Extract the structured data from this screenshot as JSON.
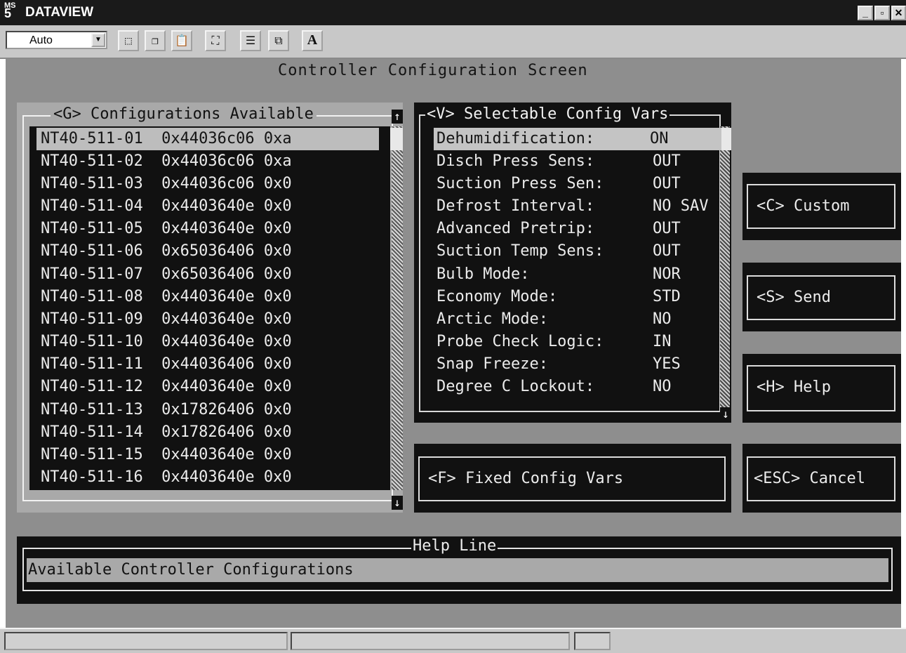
{
  "window": {
    "app_logo": "MS",
    "app_logo_num": "5",
    "title": "DATAVIEW",
    "minimize": "_",
    "maximize": "▫",
    "close": "✕"
  },
  "toolbar": {
    "zoom_value": "Auto",
    "zoom_arrow": "▼",
    "buttons": [
      {
        "icon": "select-rect-icon",
        "glyph": "⬚"
      },
      {
        "icon": "copy-icon",
        "glyph": "❐"
      },
      {
        "icon": "paste-icon",
        "glyph": "📋"
      },
      {
        "icon": "fullscreen-icon",
        "glyph": "⛶"
      },
      {
        "icon": "properties-icon",
        "glyph": "☰"
      },
      {
        "icon": "window-icon",
        "glyph": "⧉"
      },
      {
        "icon": "font-icon",
        "glyph": "A"
      }
    ]
  },
  "screen": {
    "title": "Controller Configuration Screen"
  },
  "configurations": {
    "title": "<G> Configurations Available",
    "scroll_up": "↑",
    "scroll_down": "↓",
    "rows": [
      "NT40-511-01  0x44036c06 0xa",
      "NT40-511-02  0x44036c06 0xa",
      "NT40-511-03  0x44036c06 0x0",
      "NT40-511-04  0x4403640e 0x0",
      "NT40-511-05  0x4403640e 0x0",
      "NT40-511-06  0x65036406 0x0",
      "NT40-511-07  0x65036406 0x0",
      "NT40-511-08  0x4403640e 0x0",
      "NT40-511-09  0x4403640e 0x0",
      "NT40-511-10  0x4403640e 0x0",
      "NT40-511-11  0x44036406 0x0",
      "NT40-511-12  0x4403640e 0x0",
      "NT40-511-13  0x17826406 0x0",
      "NT40-511-14  0x17826406 0x0",
      "NT40-511-15  0x4403640e 0x0",
      "NT40-511-16  0x4403640e 0x0"
    ]
  },
  "vars": {
    "title": "<V> Selectable Config Vars",
    "scroll_down": "↓",
    "rows": [
      {
        "label": "Dehumidification:",
        "value": "ON"
      },
      {
        "label": "Disch Press Sens:",
        "value": "OUT"
      },
      {
        "label": "Suction Press Sen:",
        "value": "OUT"
      },
      {
        "label": "Defrost Interval:",
        "value": "NO SAV"
      },
      {
        "label": "Advanced Pretrip:",
        "value": "OUT"
      },
      {
        "label": "Suction Temp Sens:",
        "value": "OUT"
      },
      {
        "label": "Bulb Mode:",
        "value": "NOR"
      },
      {
        "label": "Economy Mode:",
        "value": "STD"
      },
      {
        "label": "Arctic Mode:",
        "value": "NO"
      },
      {
        "label": "Probe Check Logic:",
        "value": "IN"
      },
      {
        "label": "Snap Freeze:",
        "value": "YES"
      },
      {
        "label": "Degree C Lockout:",
        "value": "NO"
      }
    ]
  },
  "buttons": {
    "custom": "<C> Custom",
    "send": "<S> Send",
    "help": "<H> Help",
    "fixed": "<F> Fixed Config Vars",
    "cancel": "<ESC> Cancel"
  },
  "help_line": {
    "title": "Help Line",
    "text": "Available Controller Configurations"
  }
}
